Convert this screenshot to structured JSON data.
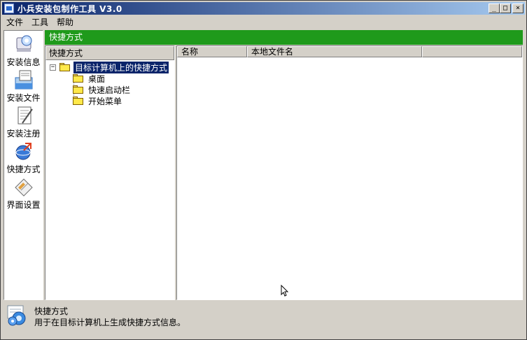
{
  "window": {
    "title": "小兵安装包制作工具  V3.0",
    "controls": {
      "minimize": "_",
      "maximize": "□",
      "close": "×"
    }
  },
  "menubar": [
    "文件",
    "工具",
    "帮助"
  ],
  "sidebar": {
    "items": [
      {
        "label": "安装信息",
        "icon": "install-info-icon"
      },
      {
        "label": "安装文件",
        "icon": "install-files-icon"
      },
      {
        "label": "安装注册",
        "icon": "install-registry-icon"
      },
      {
        "label": "快捷方式",
        "icon": "shortcut-icon"
      },
      {
        "label": "界面设置",
        "icon": "interface-settings-icon"
      }
    ]
  },
  "section_header": "快捷方式",
  "tree": {
    "header": "快捷方式",
    "root": {
      "label": "目标计算机上的快捷方式",
      "expander": "−"
    },
    "children": [
      "桌面",
      "快速启动栏",
      "开始菜单"
    ]
  },
  "list": {
    "columns": [
      "名称",
      "本地文件名"
    ]
  },
  "info": {
    "title": "快捷方式",
    "description": "用于在目标计算机上生成快捷方式信息。"
  },
  "colors": {
    "title_gradient_start": "#0a246a",
    "section_header_bg": "#1f9a1b",
    "selection_bg": "#0a246a",
    "folder": "#ffe94a"
  }
}
